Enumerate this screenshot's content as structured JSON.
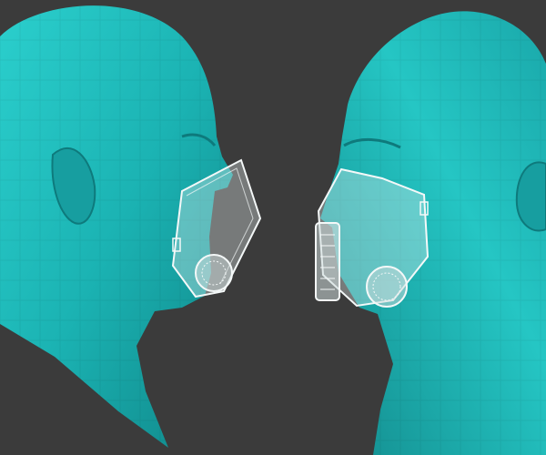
{
  "colors": {
    "background": "#3b3b3b",
    "skin": "#1bb3b3",
    "skin_light": "#2fd6d4",
    "skin_dark": "#0f7f82",
    "mask": "#e8f0f0",
    "mask_edge": "#f4f8f8"
  }
}
